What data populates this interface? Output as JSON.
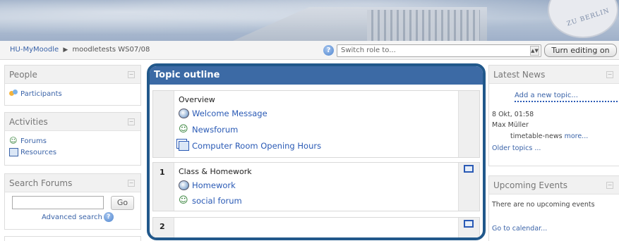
{
  "header": {
    "seal_text": "ZU BERLIN"
  },
  "navbar": {
    "breadcrumb_home": "HU-MyMoodle",
    "breadcrumb_separator": "▶",
    "breadcrumb_course": "moodletests WS07/08",
    "role_select_value": "Switch role to...",
    "edit_button_label": "Turn editing on"
  },
  "left": {
    "people": {
      "title": "People",
      "items": [
        {
          "label": "Participants",
          "icon": "participants-icon"
        }
      ]
    },
    "activities": {
      "title": "Activities",
      "items": [
        {
          "label": "Forums",
          "icon": "forum-icon"
        },
        {
          "label": "Resources",
          "icon": "resource-icon"
        }
      ]
    },
    "search": {
      "title": "Search Forums",
      "go_label": "Go",
      "advanced_label": "Advanced search"
    }
  },
  "topics": {
    "title": "Topic outline",
    "overview": {
      "summary": "Overview",
      "items": [
        {
          "label": "Welcome Message",
          "icon": "globe-icon"
        },
        {
          "label": "Newsforum",
          "icon": "forum-icon"
        },
        {
          "label": "Computer Room Opening Hours",
          "icon": "page-icon"
        }
      ]
    },
    "sections": [
      {
        "number": "1",
        "summary": "Class & Homework",
        "items": [
          {
            "label": "Homework",
            "icon": "globe-icon"
          },
          {
            "label": "social forum",
            "icon": "forum-icon"
          }
        ]
      },
      {
        "number": "2",
        "summary": "",
        "items": []
      }
    ]
  },
  "right": {
    "news": {
      "title": "Latest News",
      "add_topic": "Add a new topic...",
      "date": "8 Okt, 01:58",
      "author": "Max Müller",
      "body": "timetable-news",
      "more": "more...",
      "older": "Older topics ..."
    },
    "events": {
      "title": "Upcoming Events",
      "none_text": "There are no upcoming events",
      "calendar_link": "Go to calendar..."
    }
  },
  "colors": {
    "accent": "#3c6aa5",
    "highlight_border": "#21588b",
    "link": "#2a5ab5"
  }
}
